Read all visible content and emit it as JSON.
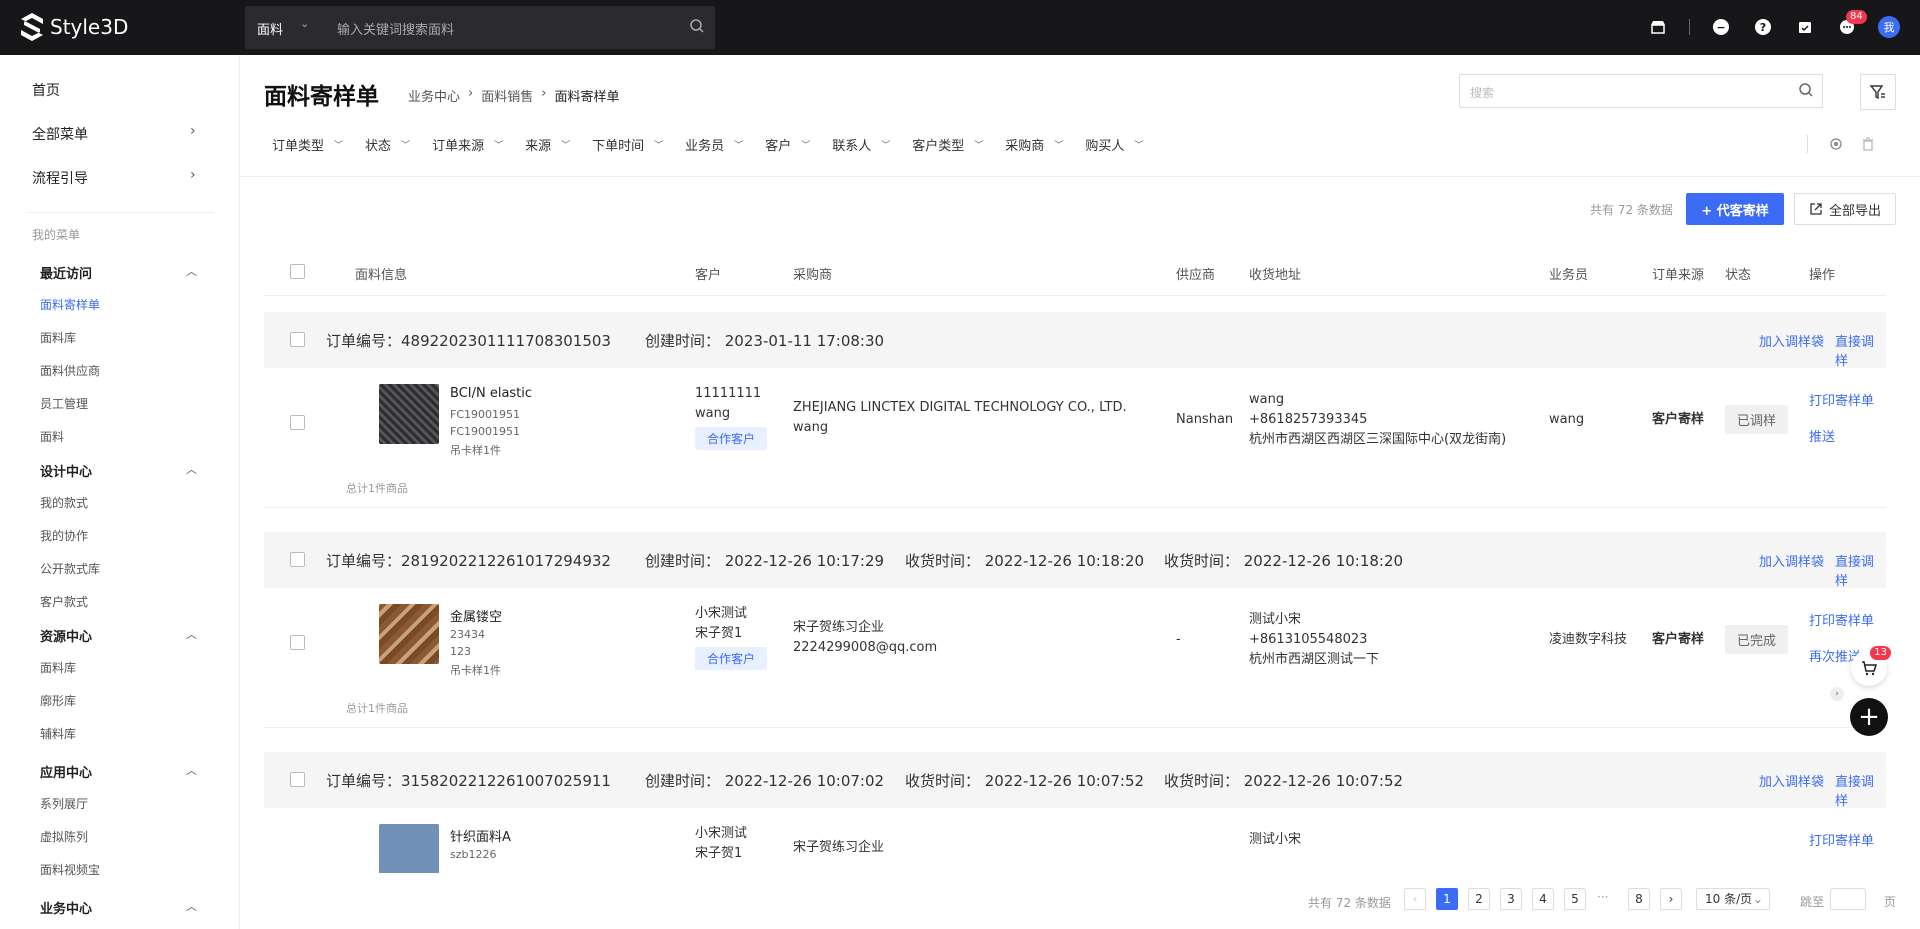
{
  "app": {
    "brand": "Style3D"
  },
  "topbar": {
    "search_category": "面料",
    "search_placeholder": "输入关键词搜索面料",
    "message_badge": "84",
    "avatar_text": "我"
  },
  "sidebar": {
    "top_items": [
      {
        "label": "首页"
      },
      {
        "label": "全部菜单"
      },
      {
        "label": "流程引导"
      }
    ],
    "my_menu_label": "我的菜单",
    "groups": [
      {
        "label": "最近访问",
        "items": [
          "面料寄样单",
          "面料库",
          "面料供应商",
          "员工管理",
          "面料"
        ]
      },
      {
        "label": "设计中心",
        "items": [
          "我的款式",
          "我的协作",
          "公开款式库",
          "客户款式"
        ]
      },
      {
        "label": "资源中心",
        "items": [
          "面料库",
          "廓形库",
          "辅料库"
        ]
      },
      {
        "label": "应用中心",
        "items": [
          "系列展厅",
          "虚拟陈列",
          "面料视频宝"
        ]
      },
      {
        "label": "业务中心",
        "items": []
      }
    ]
  },
  "page": {
    "title": "面料寄样单",
    "breadcrumb": [
      "业务中心",
      "面料销售",
      "面料寄样单"
    ],
    "search_placeholder": "搜索"
  },
  "filters": [
    "订单类型",
    "状态",
    "订单来源",
    "来源",
    "下单时间",
    "业务员",
    "客户",
    "联系人",
    "客户类型",
    "采购商",
    "购买人"
  ],
  "toolbar": {
    "total_text": "共有 72 条数据",
    "primary_button": "+ 代客寄样",
    "export_button": "全部导出"
  },
  "table": {
    "columns": [
      "面料信息",
      "客户",
      "采购商",
      "供应商",
      "收货地址",
      "业务员",
      "订单来源",
      "状态",
      "操作"
    ]
  },
  "orders": [
    {
      "order_no": "订单编号：489220230111170830​1503",
      "created": "创建时间：  2023-01-11 17:08:30",
      "received1": "",
      "received2": "",
      "actions": [
        "加入调样袋",
        "直接调样"
      ],
      "product_name": "BCI/N elastic",
      "product_sub": [
        "FC19001951",
        "FC19001951",
        "吊卡样1件"
      ],
      "total_items": "总计1件商品",
      "customer": [
        "11111111",
        "wang"
      ],
      "customer_tag": "合作客户",
      "buyer": [
        "ZHEJIANG LINCTEX DIGITAL TECHNOLOGY CO., LTD.",
        "wang"
      ],
      "supplier": "Nanshan",
      "address": [
        "wang",
        "+8618257393345",
        "杭州市西湖区西湖区三深国际中心(双龙街南)"
      ],
      "salesperson": "wang",
      "source": "客户寄样",
      "status": "已调样",
      "ops": [
        "打印寄样单",
        "推送"
      ],
      "thumb_color": "#3a3a3e"
    },
    {
      "order_no": "订单编号：281920221226101729​4932",
      "created": "创建时间：  2022-12-26 10:17:29",
      "received1": "收货时间：  2022-12-26 10:18:20",
      "received2": "收货时间：  2022-12-26 10:18:20",
      "actions": [
        "加入调样袋",
        "直接调样"
      ],
      "product_name": "金属镂空",
      "product_sub": [
        "23434",
        "123",
        "吊卡样1件"
      ],
      "total_items": "总计1件商品",
      "customer": [
        "小宋测试",
        "宋子贺1"
      ],
      "customer_tag": "合作客户",
      "buyer": [
        "宋子贺练习企业",
        "2224299008@qq.com"
      ],
      "supplier": "-",
      "address": [
        "测试小宋",
        "+8613105548023",
        "杭州市西湖区测试一下"
      ],
      "salesperson": "凌迪数字科技",
      "source": "客户寄样",
      "status": "已完成",
      "ops": [
        "打印寄样单",
        "再次推送"
      ],
      "thumb_color": "#9b6b43"
    },
    {
      "order_no": "订单编号：315820221226100702​5911",
      "created": "创建时间：  2022-12-26 10:07:02",
      "received1": "收货时间：  2022-12-26 10:07:52",
      "received2": "收货时间：  2022-12-26 10:07:52",
      "actions": [
        "加入调样袋",
        "直接调样"
      ],
      "product_name": "针织面料A",
      "product_sub": [
        "szb1226",
        "",
        ""
      ],
      "total_items": "",
      "customer": [
        "小宋测试",
        "宋子贺1"
      ],
      "customer_tag": "",
      "buyer": [
        "宋子贺练习企业",
        ""
      ],
      "supplier": "",
      "address": [
        "测试小宋",
        "",
        ""
      ],
      "salesperson": "",
      "source": "",
      "status": "",
      "ops": [
        "打印寄样单",
        ""
      ],
      "thumb_color": "#7090b8"
    }
  ],
  "pagination": {
    "total_text": "共有 72 条数据",
    "pages": [
      "1",
      "2",
      "3",
      "4",
      "5",
      "8"
    ],
    "ellipsis": "···",
    "page_size": "10 条/页",
    "goto_label": "跳至",
    "page_label": "页"
  },
  "floating": {
    "cart_badge": "13",
    "add_symbol": "+"
  },
  "colors": {
    "accent": "#3c6cf5",
    "topbar": "#17171a",
    "badge": "#f5364d"
  }
}
